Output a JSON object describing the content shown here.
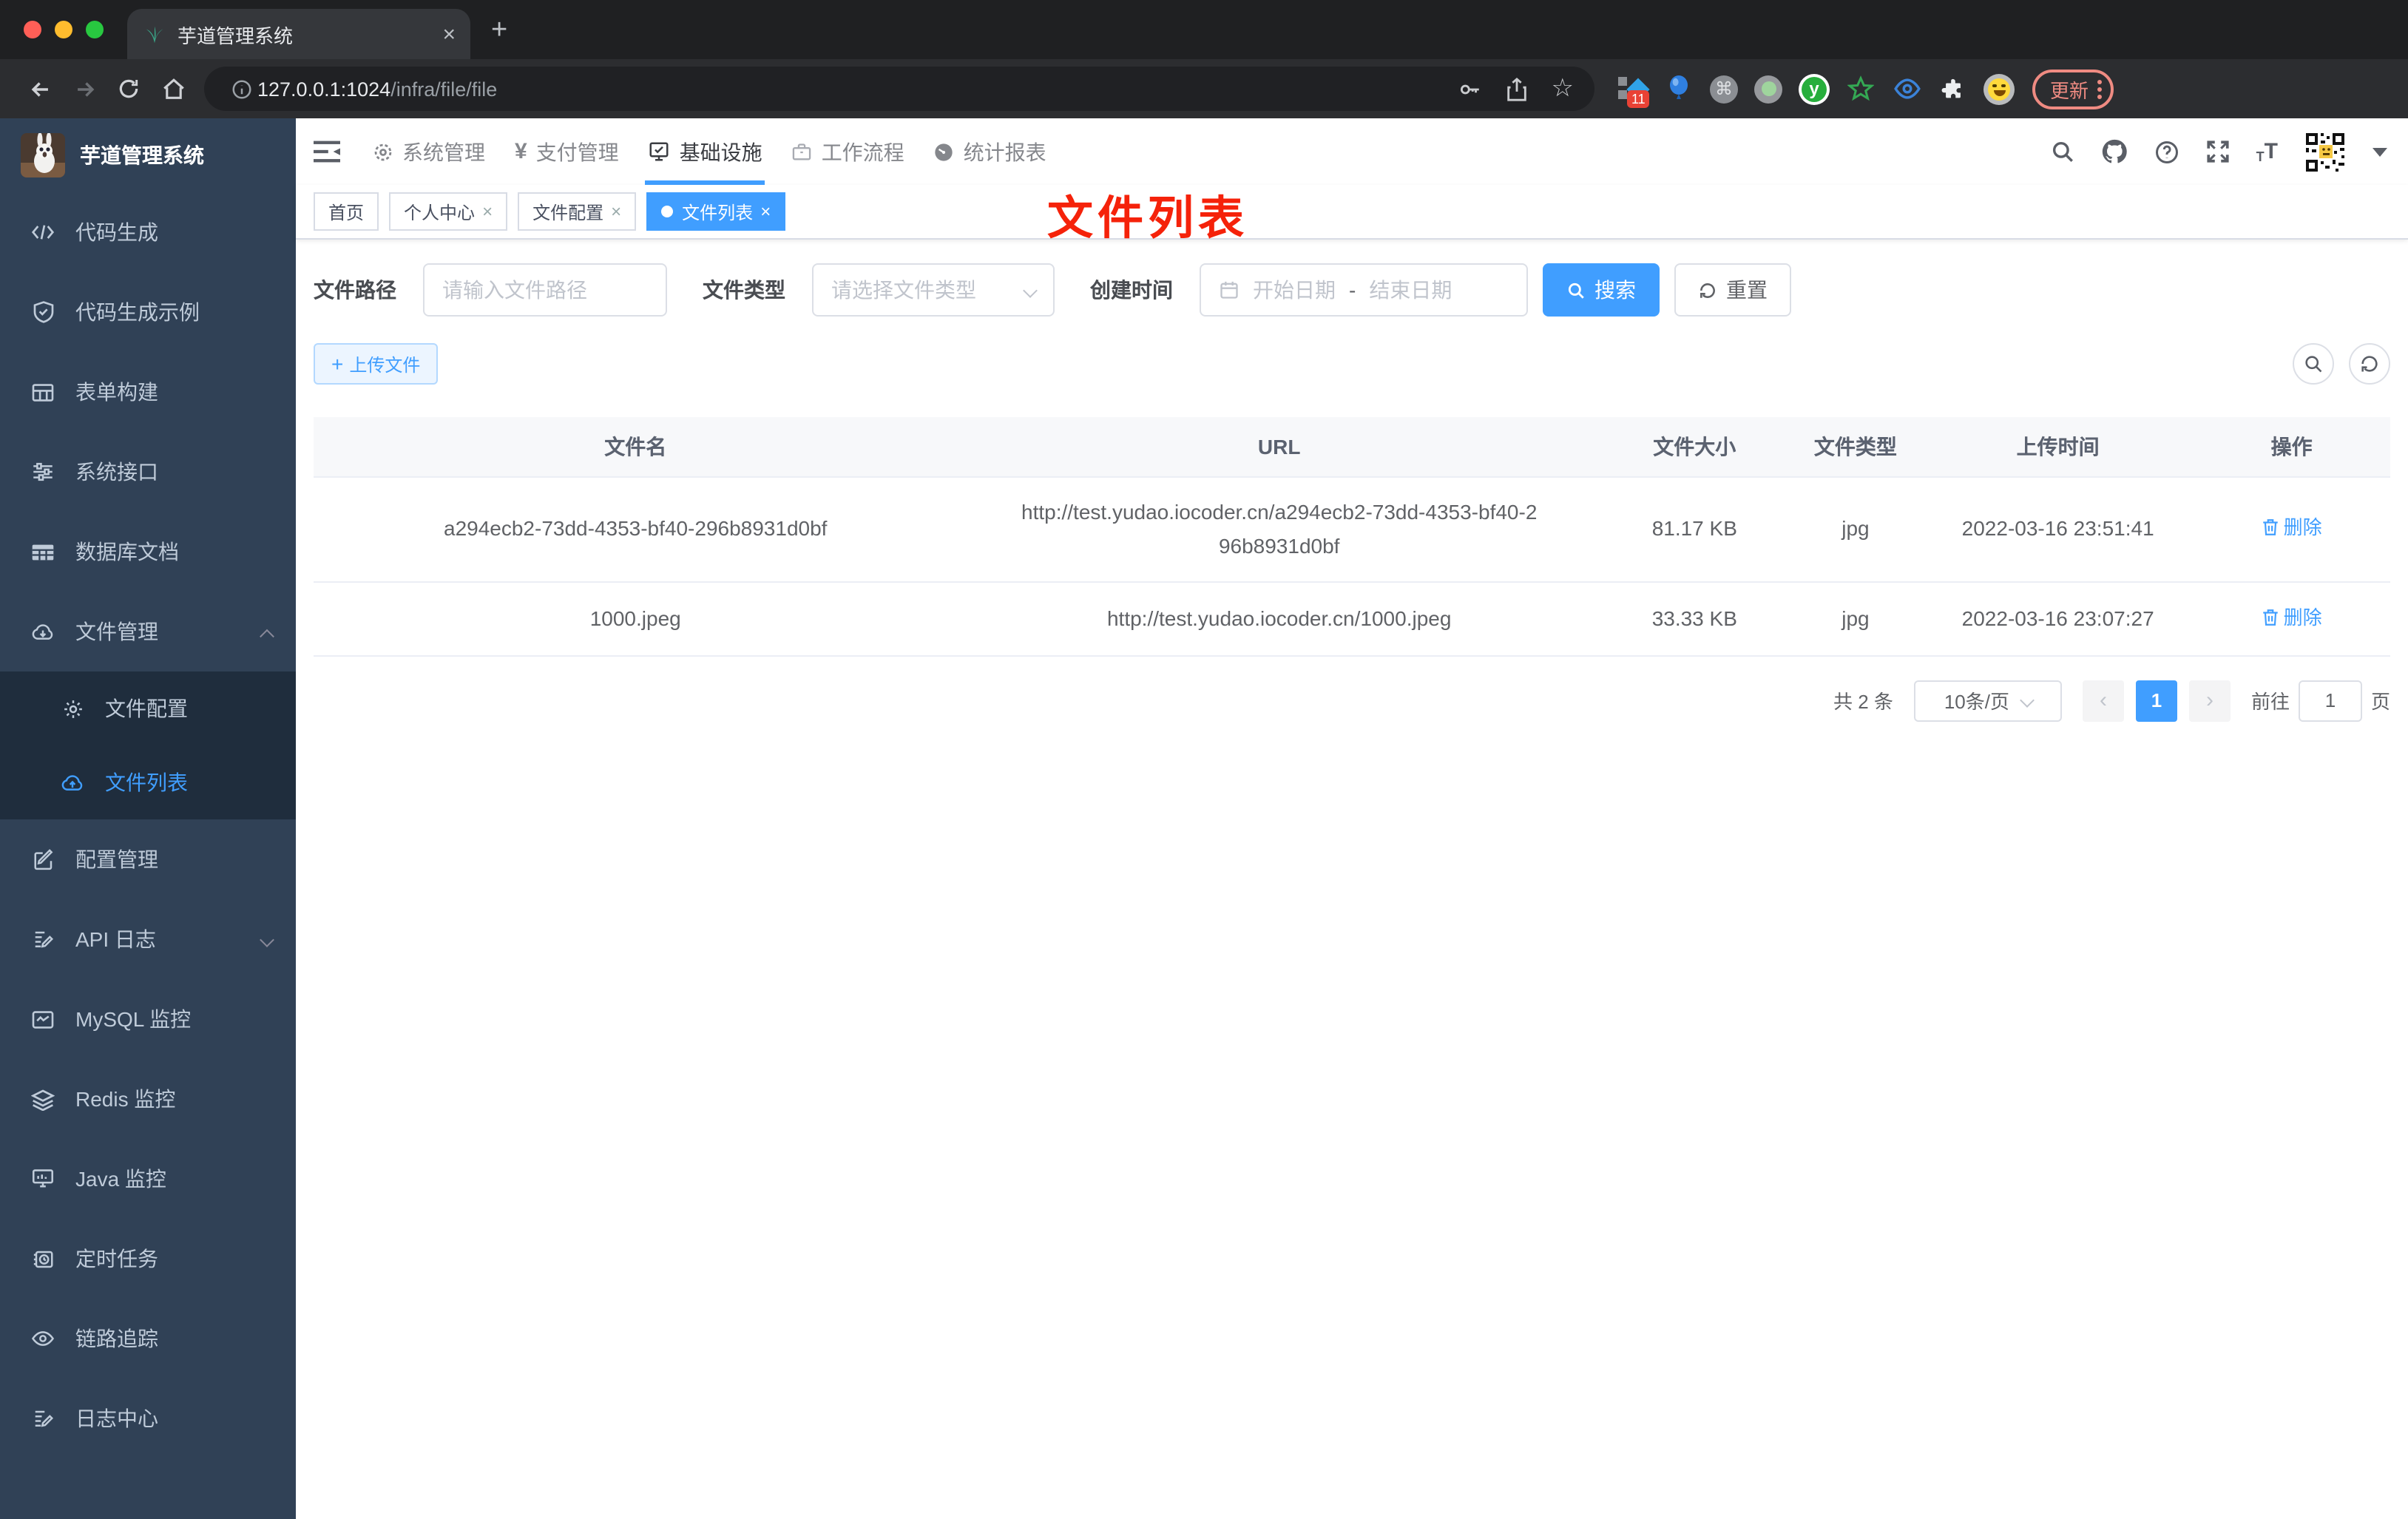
{
  "browser": {
    "tab_title": "芋道管理系统",
    "url_host": "127.0.0.1:1024",
    "url_path": "/infra/file/file",
    "ext_badge": "11",
    "update_label": "更新"
  },
  "sidebar": {
    "title": "芋道管理系统",
    "items": [
      {
        "label": "代码生成"
      },
      {
        "label": "代码生成示例"
      },
      {
        "label": "表单构建"
      },
      {
        "label": "系统接口"
      },
      {
        "label": "数据库文档"
      },
      {
        "label": "文件管理"
      },
      {
        "label": "配置管理"
      },
      {
        "label": "API 日志"
      },
      {
        "label": "MySQL 监控"
      },
      {
        "label": "Redis 监控"
      },
      {
        "label": "Java 监控"
      },
      {
        "label": "定时任务"
      },
      {
        "label": "链路追踪"
      },
      {
        "label": "日志中心"
      }
    ],
    "submenu": [
      {
        "label": "文件配置"
      },
      {
        "label": "文件列表",
        "active": true
      }
    ]
  },
  "nav": {
    "items": [
      {
        "label": "系统管理"
      },
      {
        "label": "支付管理"
      },
      {
        "label": "基础设施",
        "active": true
      },
      {
        "label": "工作流程"
      },
      {
        "label": "统计报表"
      }
    ]
  },
  "tags": [
    {
      "label": "首页",
      "closable": false
    },
    {
      "label": "个人中心",
      "closable": true
    },
    {
      "label": "文件配置",
      "closable": true
    },
    {
      "label": "文件列表",
      "closable": true,
      "active": true
    }
  ],
  "annotation": "文件列表",
  "filters": {
    "path_label": "文件路径",
    "path_placeholder": "请输入文件路径",
    "type_label": "文件类型",
    "type_placeholder": "请选择文件类型",
    "date_label": "创建时间",
    "date_start": "开始日期",
    "date_sep": "-",
    "date_end": "结束日期",
    "search_label": "搜索",
    "reset_label": "重置"
  },
  "toolbar": {
    "upload_label": "上传文件"
  },
  "table": {
    "columns": [
      "文件名",
      "URL",
      "文件大小",
      "文件类型",
      "上传时间",
      "操作"
    ],
    "rows": [
      {
        "name": "a294ecb2-73dd-4353-bf40-296b8931d0bf",
        "url": "http://test.yudao.iocoder.cn/a294ecb2-73dd-4353-bf40-296b8931d0bf",
        "size": "81.17 KB",
        "type": "jpg",
        "time": "2022-03-16 23:51:41",
        "action": "删除"
      },
      {
        "name": "1000.jpeg",
        "url": "http://test.yudao.iocoder.cn/1000.jpeg",
        "size": "33.33 KB",
        "type": "jpg",
        "time": "2022-03-16 23:07:27",
        "action": "删除"
      }
    ]
  },
  "pagination": {
    "total": "共 2 条",
    "per_page": "10条/页",
    "page": "1",
    "goto_label": "前往",
    "goto_value": "1",
    "unit": "页"
  },
  "colors": {
    "accent": "#409eff",
    "sidebar_bg": "#304156",
    "submenu_bg": "#1f2d3d",
    "annotation_red": "#f5220a",
    "update_pink": "#ef8b82",
    "tag_active": "#409eff"
  }
}
